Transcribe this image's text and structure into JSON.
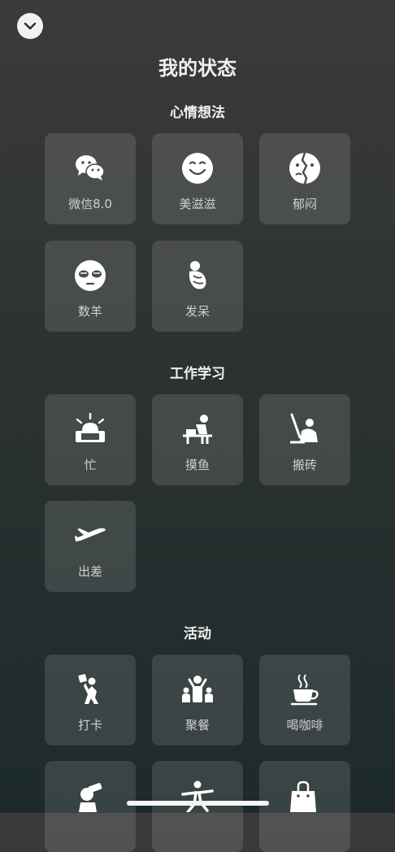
{
  "title": "我的状态",
  "sections": {
    "mood": {
      "title": "心情想法",
      "items": [
        {
          "label": "微信8.0",
          "icon": "wechat-icon"
        },
        {
          "label": "美滋滋",
          "icon": "smile-icon"
        },
        {
          "label": "郁闷",
          "icon": "depressed-icon"
        },
        {
          "label": "数羊",
          "icon": "sleepy-face-icon"
        },
        {
          "label": "发呆",
          "icon": "daze-figure-icon"
        }
      ]
    },
    "work": {
      "title": "工作学习",
      "items": [
        {
          "label": "忙",
          "icon": "alarm-siren-icon"
        },
        {
          "label": "摸鱼",
          "icon": "desk-slacking-icon"
        },
        {
          "label": "搬砖",
          "icon": "worker-icon"
        },
        {
          "label": "出差",
          "icon": "airplane-icon"
        }
      ]
    },
    "activity": {
      "title": "活动",
      "items": [
        {
          "label": "打卡",
          "icon": "check-in-figure-icon"
        },
        {
          "label": "聚餐",
          "icon": "gathering-icon"
        },
        {
          "label": "喝咖啡",
          "icon": "coffee-cup-icon"
        },
        {
          "label": "",
          "icon": "drinking-figure-icon"
        },
        {
          "label": "",
          "icon": "exercise-figure-icon"
        },
        {
          "label": "",
          "icon": "shopping-bag-icon"
        }
      ]
    }
  }
}
